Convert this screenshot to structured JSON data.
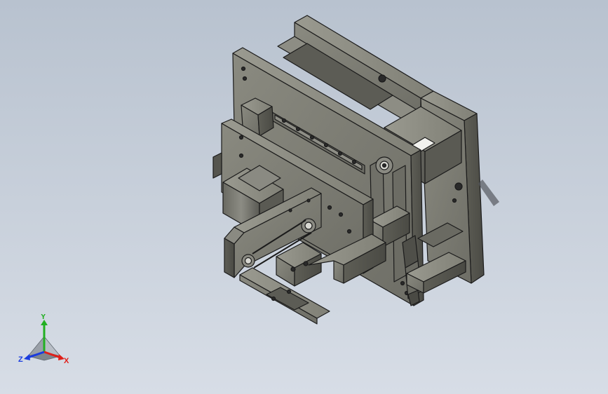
{
  "viewport": {
    "background_top": "#b8c2cf",
    "background_bottom": "#d7dde6"
  },
  "model": {
    "part_color": "#7a7a70",
    "edge_color": "#1b1b1b",
    "hole_color": "#2a2a2a"
  },
  "triad": {
    "x_label": "X",
    "y_label": "Y",
    "z_label": "Z",
    "x_color": "#e0201a",
    "y_color": "#22b022",
    "z_color": "#1a3ce0"
  }
}
